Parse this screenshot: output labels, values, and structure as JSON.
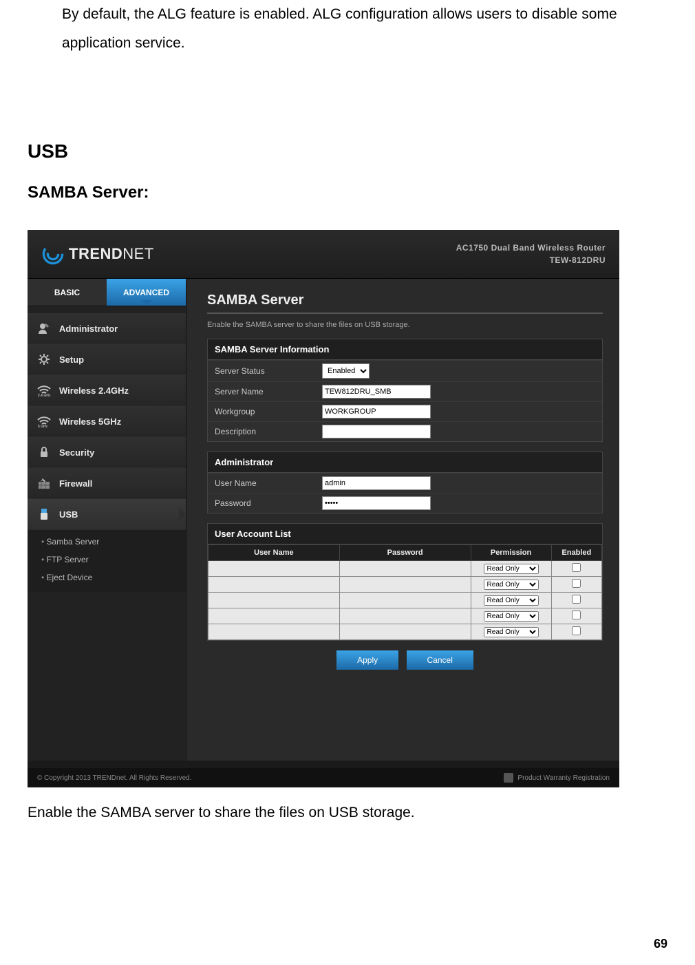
{
  "intro_text": "By default, the ALG feature is enabled. ALG configuration allows users to disable some application service.",
  "heading_usb": "USB",
  "heading_samba": "SAMBA Server:",
  "caption": "Enable the SAMBA server to share the files on USB storage.",
  "page_number": "69",
  "shot": {
    "brand": "TRENDNET",
    "model_line1": "AC1750 Dual Band Wireless Router",
    "model_line2": "TEW-812DRU",
    "tabs": {
      "basic": "BASIC",
      "advanced": "ADVANCED"
    },
    "nav": {
      "administrator": "Administrator",
      "setup": "Setup",
      "wireless24": "Wireless 2.4GHz",
      "wireless5": "Wireless 5GHz",
      "security": "Security",
      "firewall": "Firewall",
      "usb": "USB"
    },
    "subnav": {
      "samba": "Samba Server",
      "ftp": "FTP Server",
      "eject": "Eject Device"
    },
    "main": {
      "title": "SAMBA Server",
      "desc": "Enable the SAMBA server to share the files on USB storage.",
      "info_head": "SAMBA Server Information",
      "status_label": "Server Status",
      "status_value": "Enabled",
      "name_label": "Server Name",
      "name_value": "TEW812DRU_SMB",
      "workgroup_label": "Workgroup",
      "workgroup_value": "WORKGROUP",
      "desc_label": "Description",
      "desc_value": "",
      "admin_head": "Administrator",
      "admin_user_label": "User Name",
      "admin_user_value": "admin",
      "admin_pass_label": "Password",
      "admin_pass_value": "•••••",
      "acct_head": "User Account List",
      "acct_cols": {
        "user": "User Name",
        "pass": "Password",
        "perm": "Permission",
        "enabled": "Enabled"
      },
      "perm_option": "Read Only",
      "apply": "Apply",
      "cancel": "Cancel"
    },
    "footer": {
      "copyright": "© Copyright 2013 TRENDnet. All Rights Reserved.",
      "warranty": "Product Warranty Registration"
    }
  }
}
